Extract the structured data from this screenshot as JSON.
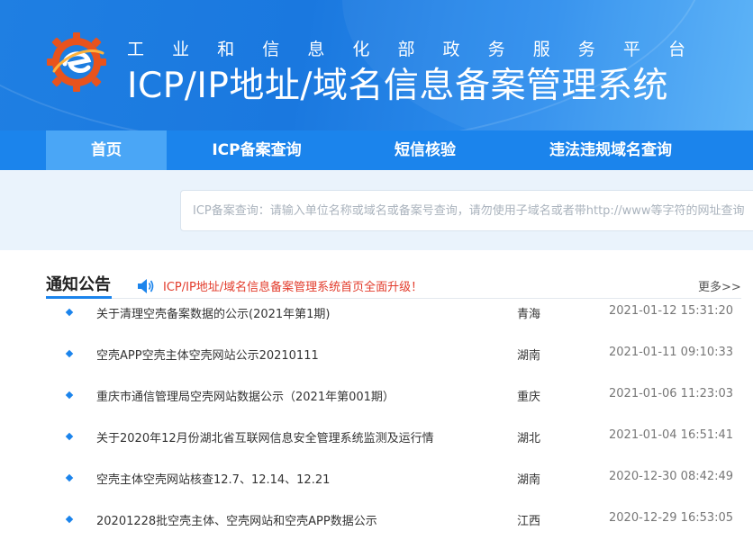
{
  "header": {
    "subtitle_chars": [
      "工",
      "业",
      "和",
      "信",
      "息",
      "化",
      "部",
      "政",
      "务",
      "服",
      "务",
      "平",
      "台"
    ],
    "title": "ICP/IP地址/域名信息备案管理系统",
    "logo": "miit-e-gear-logo"
  },
  "nav": {
    "items": [
      {
        "label": "首页",
        "active": true
      },
      {
        "label": "ICP备案查询",
        "active": false
      },
      {
        "label": "短信核验",
        "active": false
      },
      {
        "label": "违法违规域名查询",
        "active": false
      }
    ]
  },
  "search": {
    "placeholder": "ICP备案查询：请输入单位名称或域名或备案号查询，请勿使用子域名或者带http://www等字符的网址查询"
  },
  "notice": {
    "title": "通知公告",
    "announcement": "ICP/IP地址/域名信息备案管理系统首页全面升级！",
    "more": "更多>>",
    "speaker_icon": "speaker-icon",
    "rows": [
      {
        "title": "关于清理空壳备案数据的公示(2021年第1期)",
        "region": "青海",
        "time": "2021-01-12 15:31:20"
      },
      {
        "title": "空壳APP空壳主体空壳网站公示20210111",
        "region": "湖南",
        "time": "2021-01-11 09:10:33"
      },
      {
        "title": "重庆市通信管理局空壳网站数据公示（2021年第001期）",
        "region": "重庆",
        "time": "2021-01-06 11:23:03"
      },
      {
        "title": "关于2020年12月份湖北省互联网信息安全管理系统监测及运行情",
        "region": "湖北",
        "time": "2021-01-04 16:51:41"
      },
      {
        "title": "空壳主体空壳网站核查12.7、12.14、12.21",
        "region": "湖南",
        "time": "2020-12-30 08:42:49"
      },
      {
        "title": "20201228批空壳主体、空壳网站和空壳APP数据公示",
        "region": "江西",
        "time": "2020-12-29 16:53:05"
      }
    ]
  },
  "colors": {
    "brand_blue": "#1b84ec",
    "nav_active": "#4aa6f6",
    "announce_red": "#e23b2b",
    "logo_orange": "#e8531d"
  }
}
